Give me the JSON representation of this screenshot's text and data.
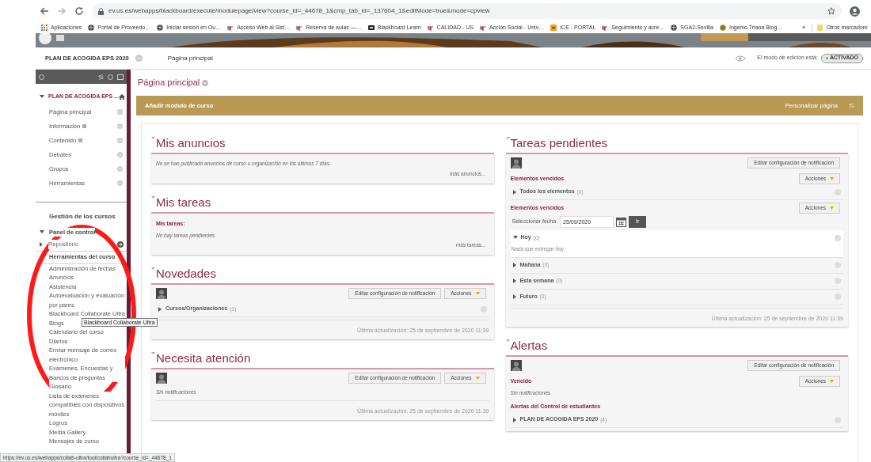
{
  "browser": {
    "url": "ev.us.es/webapps/blackboard/execute/modulepage/view?course_id=_44678_1&cmp_tab_id=_137604_1&editMode=true&mode=cpview",
    "bookmarks": [
      {
        "label": "Aplicaciones",
        "kind": "apps"
      },
      {
        "label": "Portal de Proveedo…",
        "kind": "globe"
      },
      {
        "label": "Iniciar sesión en Ou…",
        "kind": "globe"
      },
      {
        "label": "Acceso Web al Sist…",
        "kind": "us"
      },
      {
        "label": "Reserva de aulas —…",
        "kind": "us"
      },
      {
        "label": "Blackboard Learn",
        "kind": "bb"
      },
      {
        "label": "CALIDAD - US",
        "kind": "us"
      },
      {
        "label": "Acción Social - Univ…",
        "kind": "us"
      },
      {
        "label": "ICE - PORTAL",
        "kind": "ice"
      },
      {
        "label": "Seguimiento y acre…",
        "kind": "us"
      },
      {
        "label": "SGA2-Sevilla",
        "kind": "globe"
      },
      {
        "label": "Ingenio Triana Blog…",
        "kind": "dot"
      }
    ],
    "overflow": "»",
    "other_bookmarks": "Otros marcadore"
  },
  "course_bar": {
    "course": "PLAN DE ACOGIDA EPS 2020",
    "page": "Página principal",
    "edit_mode_label": "El modo de edición está:",
    "edit_mode": "ACTIVADO",
    "edit_mode_on": true
  },
  "sidebar": {
    "course_title": "PLAN DE ACOGIDA EPS ...",
    "menu": [
      {
        "label": "Página principal",
        "kind": "link"
      },
      {
        "label": "Información",
        "kind": "content"
      },
      {
        "label": "Contenido",
        "kind": "content"
      },
      {
        "label": "Debates",
        "kind": "link"
      },
      {
        "label": "Grupos",
        "kind": "link"
      },
      {
        "label": "Herramientas",
        "kind": "link"
      }
    ],
    "management_title": "Gestión de los cursos",
    "management": [
      {
        "label": "Panel de control",
        "expanded": true,
        "children": [
          {
            "label": "Repositorio",
            "expanded": false
          },
          {
            "label": "Herramientas del curso",
            "expanded": true,
            "children": [
              {
                "label": "Administración de fechas"
              },
              {
                "label": "Anuncios"
              },
              {
                "label": "Asistencia"
              },
              {
                "label": "Autoevaluación y evaluación por pares"
              },
              {
                "label": "Blackboard Collaborate Ultra"
              },
              {
                "label": "Blogs"
              },
              {
                "label": "Calendario del curso"
              },
              {
                "label": "Diarios"
              },
              {
                "label": "Enviar mensaje de correo electrónico"
              },
              {
                "label": "Exámenes, Encuestas y Bancos de preguntas"
              },
              {
                "label": "Glosario"
              },
              {
                "label": "Lista de exámenes compatibles con dispositivos móviles"
              },
              {
                "label": "Logros"
              },
              {
                "label": "Media Gallery"
              },
              {
                "label": "Mensajes de curso"
              }
            ]
          }
        ]
      }
    ],
    "tooltip": "Blackboard Collaborate Ultra"
  },
  "main": {
    "page_title": "Página principal",
    "add_module": "Añadir módulo de curso",
    "customize": "Personalizar página",
    "columns": [
      [
        {
          "title": "Mis anuncios",
          "blocks": [
            {
              "kind": "note",
              "text": "No se han publicado anuncios de curso u organización en los últimos 7 días."
            },
            {
              "kind": "more",
              "text": "más anuncios..."
            }
          ]
        },
        {
          "title": "Mis tareas",
          "blocks": [
            {
              "kind": "heading",
              "text": "Mis tareas:"
            },
            {
              "kind": "note",
              "text": "No hay tareas pendientes."
            },
            {
              "kind": "more",
              "text": "más tareas..."
            }
          ]
        },
        {
          "title": "Novedades",
          "blocks": [
            {
              "kind": "toolbar",
              "edit": "Editar configuración de notificación",
              "actions": "Acciones"
            },
            {
              "kind": "group",
              "label": "Cursos/Organizaciones",
              "count": "(1)",
              "expanded": false
            },
            {
              "kind": "updated",
              "text": "Última actualización: 25 de septiembre de 2020 11:39"
            }
          ]
        },
        {
          "title": "Necesita atención",
          "blocks": [
            {
              "kind": "toolbar",
              "edit": "Editar configuración de notificación",
              "actions": "Acciones"
            },
            {
              "kind": "note",
              "text": "Sin notificaciones"
            },
            {
              "kind": "updated",
              "text": "Última actualización: 25 de septiembre de 2020 11:39"
            }
          ]
        }
      ],
      [
        {
          "title": "Tareas pendientes",
          "blocks": [
            {
              "kind": "toolbar",
              "edit": "Editar configuración de notificación"
            },
            {
              "kind": "heading",
              "text": "Elementos vencidos",
              "actions": "Acciones"
            },
            {
              "kind": "group",
              "label": "Todos los elementos",
              "count": "(0)",
              "expanded": false
            },
            {
              "kind": "heading",
              "text": "Elementos vencidos",
              "actions": "Acciones"
            },
            {
              "kind": "date",
              "label": "Seleccionar fecha:",
              "value": "25/09/2020",
              "button": "Ir"
            },
            {
              "kind": "group",
              "label": "Hoy",
              "count": "(0)",
              "expanded": true,
              "note": "Nada que entregar hoy"
            },
            {
              "kind": "group",
              "label": "Mañana",
              "count": "(0)",
              "expanded": false
            },
            {
              "kind": "group",
              "label": "Esta semana",
              "count": "(0)",
              "expanded": false
            },
            {
              "kind": "group",
              "label": "Futuro",
              "count": "(0)",
              "expanded": false
            },
            {
              "kind": "updated",
              "text": "Última actualización: 25 de septiembre de 2020 11:39"
            }
          ]
        },
        {
          "title": "Alertas",
          "blocks": [
            {
              "kind": "toolbar",
              "edit": "Editar configuración de notificación"
            },
            {
              "kind": "heading",
              "text": "Vencido",
              "actions": "Acciones"
            },
            {
              "kind": "note",
              "text": "Sin notificaciones"
            },
            {
              "kind": "heading",
              "text": "Alertas del Control de estudiantes"
            },
            {
              "kind": "group",
              "label": "PLAN DE ACOGIDA EPS 2020",
              "count": "(4)",
              "expanded": false
            }
          ]
        }
      ]
    ]
  },
  "status_bar": "https://ev.us.es/webapps/collab-ultra/tool/collabultra?course_id=_44678_1"
}
